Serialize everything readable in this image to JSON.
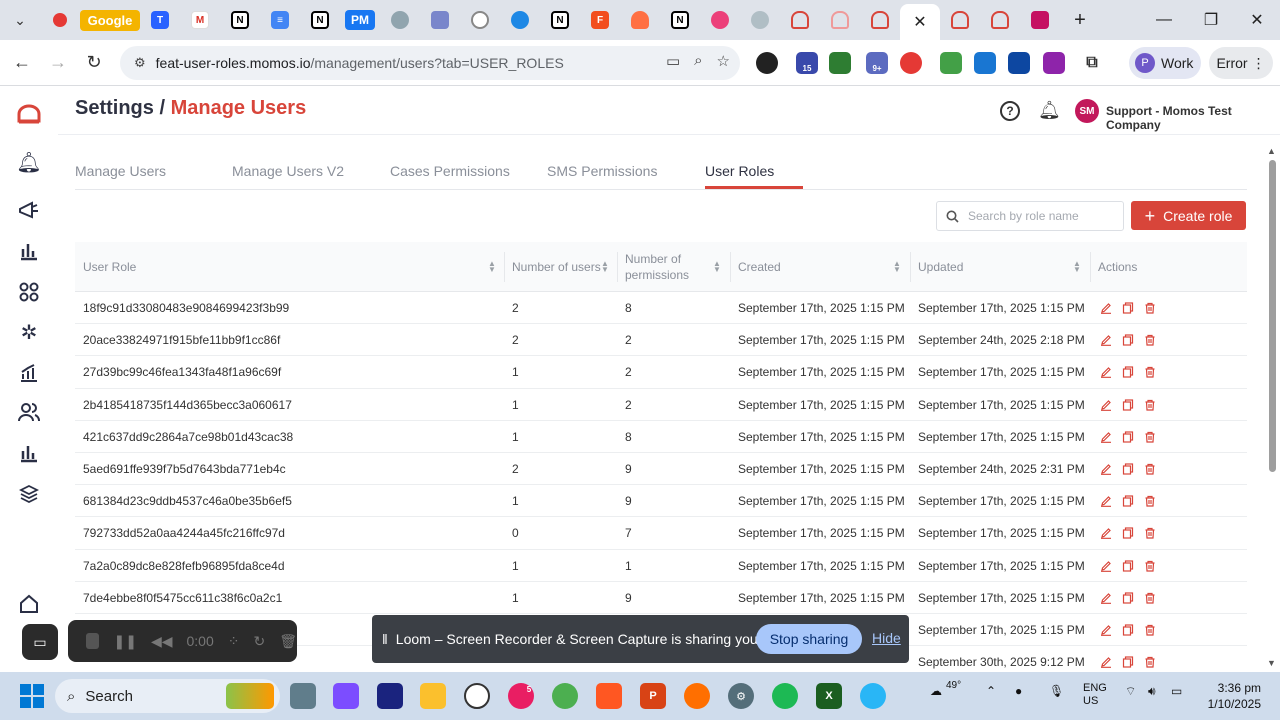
{
  "browser": {
    "url_host": "feat-user-roles.momos.io",
    "url_path": "/management/users?tab=USER_ROLES",
    "tab_google_label": "Google",
    "tab_pm_label": "PM",
    "profile_initial": "P",
    "profile_label": "Work",
    "error_label": "Error",
    "ext_badge_1": "15",
    "ext_badge_2": "9+"
  },
  "header": {
    "breadcrumb_root": "Settings /",
    "breadcrumb_current": "Manage Users",
    "avatar_initials": "SM",
    "company": "Support - Momos Test Company"
  },
  "tabs": [
    {
      "label": "Manage Users"
    },
    {
      "label": "Manage Users V2"
    },
    {
      "label": "Cases Permissions"
    },
    {
      "label": "SMS Permissions"
    },
    {
      "label": "User Roles"
    }
  ],
  "search": {
    "placeholder": "Search by role name"
  },
  "create_button": {
    "label": "Create role"
  },
  "table": {
    "columns": [
      "User Role",
      "Number of users",
      "Number of permissions",
      "Created",
      "Updated",
      "Actions"
    ],
    "rows": [
      {
        "role": "18f9c91d33080483e9084699423f3b99",
        "users": "2",
        "perms": "8",
        "created": "September 17th, 2025 1:15 PM",
        "updated": "September 17th, 2025 1:15 PM"
      },
      {
        "role": "20ace33824971f915bfe11bb9f1cc86f",
        "users": "2",
        "perms": "2",
        "created": "September 17th, 2025 1:15 PM",
        "updated": "September 24th, 2025 2:18 PM"
      },
      {
        "role": "27d39bc99c46fea1343fa48f1a96c69f",
        "users": "1",
        "perms": "2",
        "created": "September 17th, 2025 1:15 PM",
        "updated": "September 17th, 2025 1:15 PM"
      },
      {
        "role": "2b4185418735f144d365becc3a060617",
        "users": "1",
        "perms": "2",
        "created": "September 17th, 2025 1:15 PM",
        "updated": "September 17th, 2025 1:15 PM"
      },
      {
        "role": "421c637dd9c2864a7ce98b01d43cac38",
        "users": "1",
        "perms": "8",
        "created": "September 17th, 2025 1:15 PM",
        "updated": "September 17th, 2025 1:15 PM"
      },
      {
        "role": "5aed691ffe939f7b5d7643bda771eb4c",
        "users": "2",
        "perms": "9",
        "created": "September 17th, 2025 1:15 PM",
        "updated": "September 24th, 2025 2:31 PM"
      },
      {
        "role": "681384d23c9ddb4537c46a0be35b6ef5",
        "users": "1",
        "perms": "9",
        "created": "September 17th, 2025 1:15 PM",
        "updated": "September 17th, 2025 1:15 PM"
      },
      {
        "role": "792733dd52a0aa4244a45fc216ffc97d",
        "users": "0",
        "perms": "7",
        "created": "September 17th, 2025 1:15 PM",
        "updated": "September 17th, 2025 1:15 PM"
      },
      {
        "role": "7a2a0c89dc8e828fefb96895fda8ce4d",
        "users": "1",
        "perms": "1",
        "created": "September 17th, 2025 1:15 PM",
        "updated": "September 17th, 2025 1:15 PM"
      },
      {
        "role": "7de4ebbe8f0f5475cc611c38f6c0a2c1",
        "users": "1",
        "perms": "9",
        "created": "September 17th, 2025 1:15 PM",
        "updated": "September 17th, 2025 1:15 PM"
      },
      {
        "role": "",
        "users": "",
        "perms": "",
        "created": "",
        "updated": "September 17th, 2025 1:15 PM"
      },
      {
        "role": "",
        "users": "",
        "perms": "",
        "created": "",
        "updated": "September 30th, 2025 9:12 PM"
      }
    ]
  },
  "loom": {
    "timer": "0:00",
    "share_message": "Loom – Screen Recorder & Screen Capture is sharing your screen.",
    "stop_label": "Stop sharing",
    "hide_label": "Hide"
  },
  "taskbar": {
    "search_label": "Search",
    "weather": "49°",
    "lang_1": "ENG",
    "lang_2": "US",
    "time": "3:36 pm",
    "date": "1/10/2025",
    "badge_count": "5"
  },
  "colors": {
    "accent": "#d8453a",
    "text_dark": "#2f3242",
    "muted": "#8a8f99"
  }
}
